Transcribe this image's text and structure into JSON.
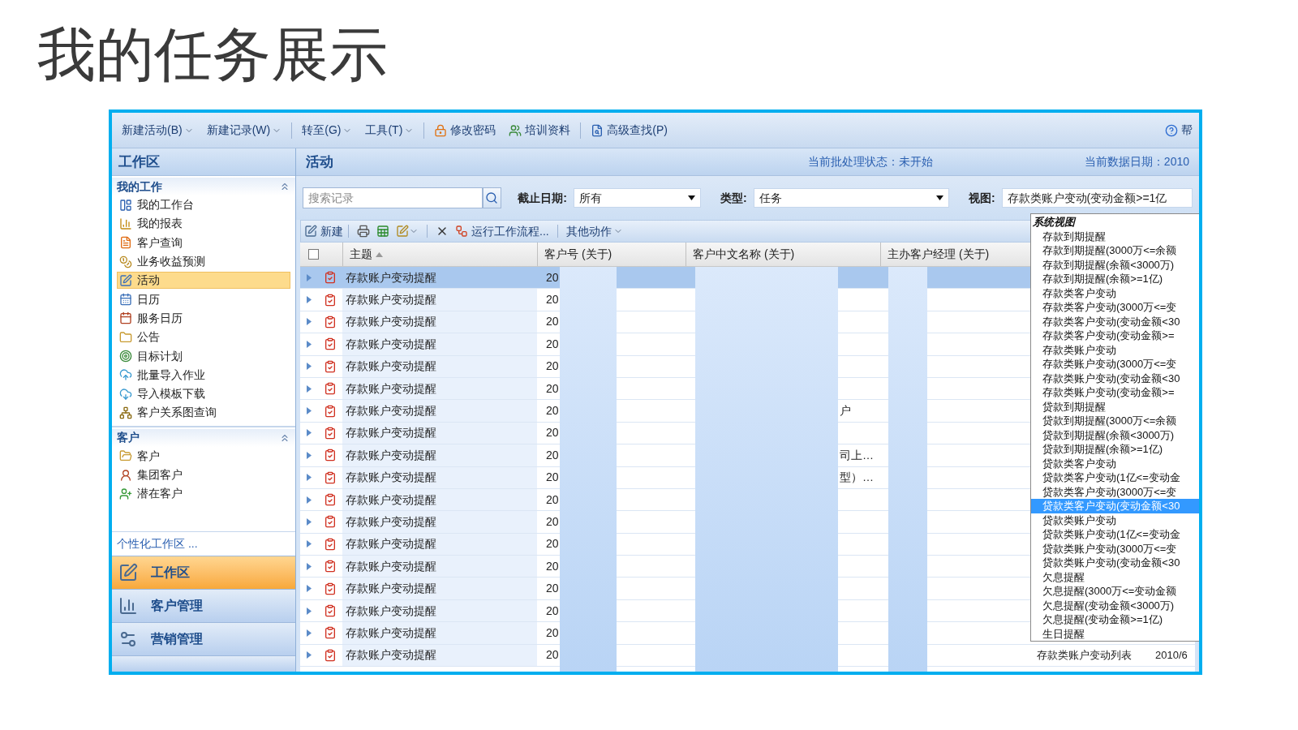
{
  "slide_title": "我的任务展示",
  "toolbar": {
    "groups": [
      [
        {
          "label": "新建活动(B)",
          "kind": "menu"
        },
        {
          "label": "新建记录(W)",
          "kind": "menu"
        }
      ],
      [
        {
          "label": "转至(G)",
          "kind": "menu"
        },
        {
          "label": "工具(T)",
          "kind": "menu"
        }
      ],
      [
        {
          "label": "修改密码",
          "kind": "link"
        },
        {
          "label": "培训资料",
          "kind": "link"
        }
      ],
      [
        {
          "label": "高级查找(P)",
          "kind": "link"
        }
      ]
    ],
    "help": "帮"
  },
  "sidebar": {
    "header": "工作区",
    "sections": [
      {
        "title": "我的工作",
        "expanded": true,
        "items": [
          {
            "label": "我的工作台",
            "selected": false
          },
          {
            "label": "我的报表",
            "selected": false
          },
          {
            "label": "客户查询",
            "selected": false
          },
          {
            "label": "业务收益预测",
            "selected": false
          },
          {
            "label": "活动",
            "selected": true
          },
          {
            "label": "日历",
            "selected": false
          },
          {
            "label": "服务日历",
            "selected": false
          },
          {
            "label": "公告",
            "selected": false
          },
          {
            "label": "目标计划",
            "selected": false
          },
          {
            "label": "批量导入作业",
            "selected": false
          },
          {
            "label": "导入模板下载",
            "selected": false
          },
          {
            "label": "客户关系图查询",
            "selected": false
          }
        ]
      },
      {
        "title": "客户",
        "expanded": true,
        "items": [
          {
            "label": "客户",
            "selected": false
          },
          {
            "label": "集团客户",
            "selected": false
          },
          {
            "label": "潜在客户",
            "selected": false
          }
        ]
      }
    ],
    "customize_link": "个性化工作区 ...",
    "nav": [
      {
        "label": "工作区",
        "selected": true
      },
      {
        "label": "客户管理",
        "selected": false
      },
      {
        "label": "营销管理",
        "selected": false
      }
    ]
  },
  "main": {
    "title": "活动",
    "batch_status": "当前批处理状态：未开始",
    "data_date": "当前数据日期：2010",
    "search": {
      "placeholder": "搜索记录"
    },
    "filters": [
      {
        "label": "截止日期:",
        "value": "所有"
      },
      {
        "label": "类型:",
        "value": "任务"
      },
      {
        "label": "视图:",
        "value": "存款类账户变动(变动金额>=1亿"
      }
    ],
    "actions": {
      "new": "新建",
      "workflow": "运行工作流程...",
      "more": "其他动作"
    },
    "view_dropdown": {
      "group": "系统视图",
      "items": [
        {
          "label": "存款到期提醒",
          "selected": false
        },
        {
          "label": "存款到期提醒(3000万<=余额",
          "selected": false
        },
        {
          "label": "存款到期提醒(余额<3000万)",
          "selected": false
        },
        {
          "label": "存款到期提醒(余额>=1亿)",
          "selected": false
        },
        {
          "label": "存款类客户变动",
          "selected": false
        },
        {
          "label": "存款类客户变动(3000万<=变",
          "selected": false
        },
        {
          "label": "存款类客户变动(变动金额<30",
          "selected": false
        },
        {
          "label": "存款类客户变动(变动金额>=",
          "selected": false
        },
        {
          "label": "存款类账户变动",
          "selected": false
        },
        {
          "label": "存款类账户变动(3000万<=变",
          "selected": false
        },
        {
          "label": "存款类账户变动(变动金额<30",
          "selected": false
        },
        {
          "label": "存款类账户变动(变动金额>=",
          "selected": false
        },
        {
          "label": "贷款到期提醒",
          "selected": false
        },
        {
          "label": "贷款到期提醒(3000万<=余额",
          "selected": false
        },
        {
          "label": "贷款到期提醒(余额<3000万)",
          "selected": false
        },
        {
          "label": "贷款到期提醒(余额>=1亿)",
          "selected": false
        },
        {
          "label": "贷款类客户变动",
          "selected": false
        },
        {
          "label": "贷款类客户变动(1亿<=变动金",
          "selected": false
        },
        {
          "label": "贷款类客户变动(3000万<=变",
          "selected": false
        },
        {
          "label": "贷款类客户变动(变动金额<30",
          "selected": true
        },
        {
          "label": "贷款类账户变动",
          "selected": false
        },
        {
          "label": "贷款类账户变动(1亿<=变动金",
          "selected": false
        },
        {
          "label": "贷款类账户变动(3000万<=变",
          "selected": false
        },
        {
          "label": "贷款类账户变动(变动金额<30",
          "selected": false
        },
        {
          "label": "欠息提醒",
          "selected": false
        },
        {
          "label": "欠息提醒(3000万<=变动金额",
          "selected": false
        },
        {
          "label": "欠息提醒(变动金额<3000万)",
          "selected": false
        },
        {
          "label": "欠息提醒(变动金额>=1亿)",
          "selected": false
        },
        {
          "label": "生日提醒",
          "selected": false
        }
      ]
    },
    "table": {
      "select_all_checked": false,
      "columns": [
        "主题",
        "客户号 (关于)",
        "客户中文名称 (关于)",
        "主办客户经理 (关于)"
      ],
      "rows": [
        {
          "subject": "存款账户变动提醒",
          "customer_no": "20",
          "selected": true
        },
        {
          "subject": "存款账户变动提醒",
          "customer_no": "20",
          "selected": false
        },
        {
          "subject": "存款账户变动提醒",
          "customer_no": "20",
          "selected": false
        },
        {
          "subject": "存款账户变动提醒",
          "customer_no": "20",
          "selected": false
        },
        {
          "subject": "存款账户变动提醒",
          "customer_no": "20",
          "selected": false
        },
        {
          "subject": "存款账户变动提醒",
          "customer_no": "20",
          "selected": false
        },
        {
          "subject": "存款账户变动提醒",
          "customer_no": "20",
          "customer_name": "户",
          "selected": false
        },
        {
          "subject": "存款账户变动提醒",
          "customer_no": "20",
          "selected": false
        },
        {
          "subject": "存款账户变动提醒",
          "customer_no": "20",
          "customer_name": "司上…",
          "selected": false
        },
        {
          "subject": "存款账户变动提醒",
          "customer_no": "20",
          "customer_name": "型）…",
          "selected": false
        },
        {
          "subject": "存款账户变动提醒",
          "customer_no": "20",
          "selected": false
        },
        {
          "subject": "存款账户变动提醒",
          "customer_no": "20",
          "selected": false
        },
        {
          "subject": "存款账户变动提醒",
          "customer_no": "20",
          "selected": false
        },
        {
          "subject": "存款账户变动提醒",
          "customer_no": "20",
          "selected": false
        },
        {
          "subject": "存款账户变动提醒",
          "customer_no": "20",
          "selected": false
        },
        {
          "subject": "存款账户变动提醒",
          "customer_no": "20",
          "selected": false
        },
        {
          "subject": "存款账户变动提醒",
          "customer_no": "20",
          "selected": false
        },
        {
          "subject": "存款账户变动提醒",
          "customer_no": "20",
          "column_5": "存款类账户变动列表",
          "column_6": "2010/6",
          "selected": false
        }
      ]
    }
  }
}
